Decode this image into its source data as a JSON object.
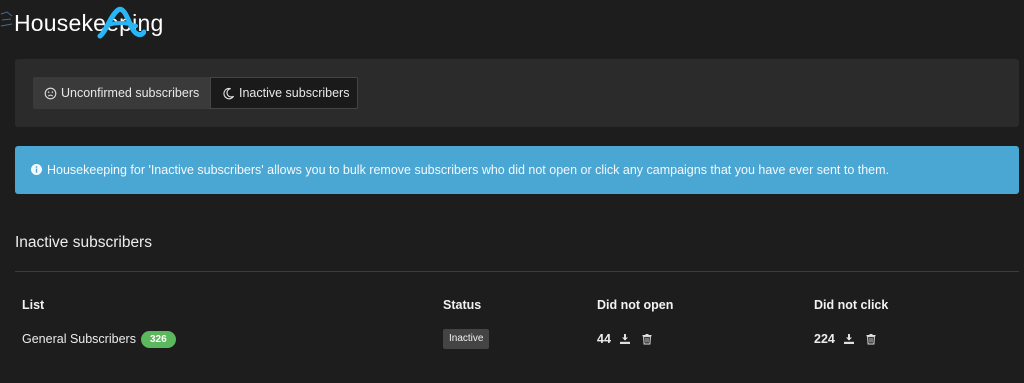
{
  "page": {
    "title": "Housekeeping"
  },
  "tabs": [
    {
      "label": "Unconfirmed subscribers",
      "icon": "frown-face-icon",
      "active": false
    },
    {
      "label": "Inactive subscribers",
      "icon": "moon-icon",
      "active": true
    }
  ],
  "alert": {
    "icon": "info-circle-icon",
    "text": "Housekeeping for 'Inactive subscribers' allows you to bulk remove subscribers who did not open or click any campaigns that you have ever sent to them.",
    "color": "#4aa6d3"
  },
  "section": {
    "heading": "Inactive subscribers"
  },
  "table": {
    "columns": [
      "List",
      "Status",
      "Did not open",
      "Did not click"
    ],
    "rows": [
      {
        "list": "General Subscribers",
        "count": "326",
        "status": "Inactive",
        "did_not_open": "44",
        "did_not_click": "224"
      }
    ]
  },
  "colors": {
    "background": "#1d1d1d",
    "panel": "#2b2b2b",
    "badge_green": "#5cb85c",
    "logo_blue": "#29b6f6"
  }
}
